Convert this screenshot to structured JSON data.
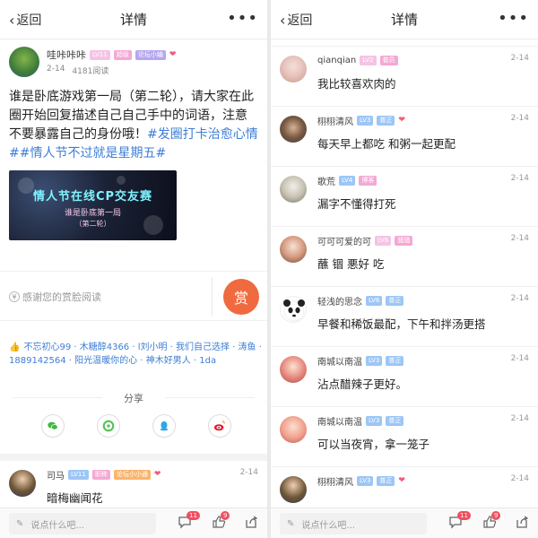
{
  "left": {
    "nav": {
      "back": "返回",
      "title": "详情",
      "more": "•••"
    },
    "author": {
      "name": "哇咔咔咔",
      "lv": "LV11",
      "badge1": "超级",
      "badge2": "论坛小编",
      "date": "2-14",
      "reads": "4181阅读"
    },
    "post": {
      "text": "谁是卧底游戏第一局（第二轮），请大家在此圈开始回复描述自己自己手中的词语，注意不要暴露自己的身份哦！",
      "tag1": "#发圈打卡治愈心情#",
      "tag2": "#情人节不过就是星期五#"
    },
    "banner": {
      "line1": "情人节在线CP交友赛",
      "line2": "谁是卧底第一局",
      "line3": "（第二轮）"
    },
    "reward": {
      "text": "感谢您的赏脸阅读",
      "button": "赏"
    },
    "likes": "不忘初心99 · 木糖醇4366 · l刘小明 · 我们自己选择 · 涛鱼 · 1889142564 · 阳光温暖你的心 · 神木好男人 · 1da",
    "share": {
      "label": "分享"
    },
    "first_comment": {
      "name": "司马",
      "lv": "LV11",
      "badge1": "职称",
      "badge2": "论坛小小通",
      "date": "2-14",
      "text": "暗梅幽闻花"
    },
    "bottom": {
      "placeholder": "说点什么吧...",
      "comments_count": "11",
      "likes_count": "9"
    }
  },
  "right": {
    "nav": {
      "back": "返回",
      "title": "详情",
      "more": "•••"
    },
    "comments": [
      {
        "name": "qianqian",
        "lv": "LV2",
        "badge": "普员",
        "date": "2-14",
        "text": "我比较喜欢肉的"
      },
      {
        "name": "栩栩清风",
        "lv": "LV3",
        "badge": "普正",
        "date": "2-14",
        "text": "每天早上都吃  和粥一起更配"
      },
      {
        "name": "歌荒",
        "lv": "LV4",
        "badge": "博客",
        "date": "2-14",
        "text": "漏字不懂得打死"
      },
      {
        "name": "可可可爱的可",
        "lv": "LV6",
        "badge": "骚骚",
        "date": "2-14",
        "text": "蘸 锢 悪好 吃"
      },
      {
        "name": "轻浅的思念",
        "lv": "LV6",
        "badge": "普正",
        "date": "2-14",
        "text": "早餐和稀饭最配，下午和拌汤更搭"
      },
      {
        "name": "南城以南温",
        "lv": "LV3",
        "badge": "普正",
        "date": "2-14",
        "text": "沾点醋辣子更好。"
      },
      {
        "name": "南城以南温",
        "lv": "LV3",
        "badge": "普正",
        "date": "2-14",
        "text": "可以当夜宵，拿一笼子"
      },
      {
        "name": "栩栩清风",
        "lv": "LV3",
        "badge": "普正",
        "date": "2-14",
        "text": ""
      }
    ],
    "bottom": {
      "placeholder": "说点什么吧...",
      "comments_count": "11",
      "likes_count": "9"
    }
  },
  "colors": {
    "accent": "#3d7ed6",
    "reward": "#f06a3f",
    "badge_red": "#f04f5e"
  }
}
